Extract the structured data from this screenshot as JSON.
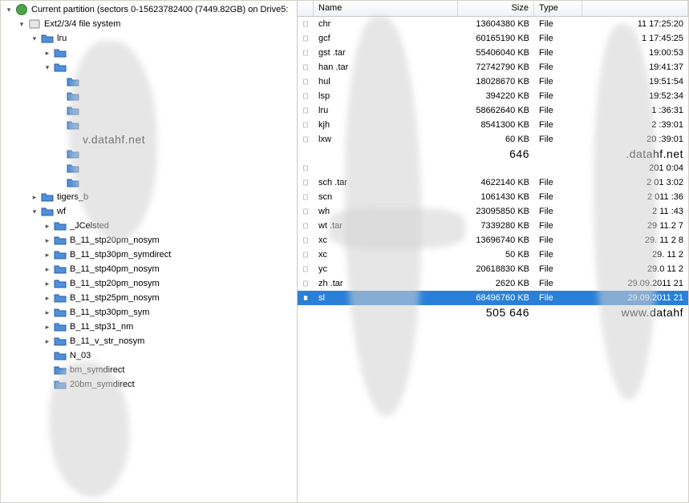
{
  "tree": {
    "root_label": "Current partition (sectors 0-15623782400 (7449.82GB) on Drive5:",
    "fs_node": "Ext2/3/4 file system",
    "lru_label": "lru",
    "watermark": "v.datahf.net",
    "tig_node": "tigers_b",
    "wf_node": "wf",
    "wf_children": [
      "_JCelsted",
      "B_11_stp20pm_nosym",
      "B_11_stp30pm_symdirect",
      "B_11_stp40pm_nosym",
      "B_11_stp20pm_nosym",
      "B_11_stp25pm_nosym",
      "B_11_stp30pm_sym",
      "B_11_stp31_nm",
      "B_11_v_str_nosym",
      "N_03",
      "bm_symdirect",
      "20bm_symdirect"
    ]
  },
  "list": {
    "headers": {
      "name": "Name",
      "size": "Size",
      "type": "Type",
      "date": ""
    },
    "rows": [
      {
        "name": "chr",
        "size": "13604380 KB",
        "type": "File",
        "date": "11 17:25:20",
        "sel": false
      },
      {
        "name": "gcf",
        "size": "60165190 KB",
        "type": "File",
        "date": "1 17:45:25",
        "sel": false
      },
      {
        "name": "gst   .tar",
        "size": "55406040 KB",
        "type": "File",
        "date": "19:00:53",
        "sel": false
      },
      {
        "name": "han   .tar",
        "size": "72742790 KB",
        "type": "File",
        "date": "19:41:37",
        "sel": false
      },
      {
        "name": "hul",
        "size": "18028670 KB",
        "type": "File",
        "date": "19:51:54",
        "sel": false
      },
      {
        "name": "lsp",
        "size": "394220 KB",
        "type": "File",
        "date": "19:52:34",
        "sel": false
      },
      {
        "name": "lru",
        "size": "58662640 KB",
        "type": "File",
        "date": "1   :36:31",
        "sel": false
      },
      {
        "name": "kjh",
        "size": "8541300 KB",
        "type": "File",
        "date": "2   :39:01",
        "sel": false
      },
      {
        "name": "lxw",
        "size": "60 KB",
        "type": "File",
        "date": "20  :39:01",
        "sel": false
      },
      {
        "name": "",
        "size": "646",
        "type": "",
        "date": ".datahf.net",
        "sel": false,
        "watermark": true
      },
      {
        "name": "",
        "size": "",
        "type": "",
        "date": "201   0:04",
        "sel": false
      },
      {
        "name": "sch   .tar",
        "size": "4622140 KB",
        "type": "File",
        "date": "2   01   3:02",
        "sel": false
      },
      {
        "name": "scn",
        "size": "1061430 KB",
        "type": "File",
        "date": "2   011   :36",
        "sel": false
      },
      {
        "name": "wh",
        "size": "23095850 KB",
        "type": "File",
        "date": "2   11   :43",
        "sel": false
      },
      {
        "name": "wt   .tar",
        "size": "7339280 KB",
        "type": "File",
        "date": "29   11.2   7",
        "sel": false
      },
      {
        "name": "xc",
        "size": "13696740 KB",
        "type": "File",
        "date": "29.   11 2   8",
        "sel": false
      },
      {
        "name": "xc",
        "size": "50 KB",
        "type": "File",
        "date": "29.   11 2",
        "sel": false
      },
      {
        "name": "yc",
        "size": "20618830 KB",
        "type": "File",
        "date": "29.0   11 2",
        "sel": false
      },
      {
        "name": "zh   .tar",
        "size": "2620 KB",
        "type": "File",
        "date": "29.09.2011 21",
        "sel": false
      },
      {
        "name": "sl",
        "size": "68496760 KB",
        "type": "File",
        "date": "29.09.2011 21",
        "sel": true
      },
      {
        "name": "",
        "size": "505 646",
        "type": "",
        "date": "www.datahf",
        "sel": false,
        "watermark": true
      }
    ]
  }
}
